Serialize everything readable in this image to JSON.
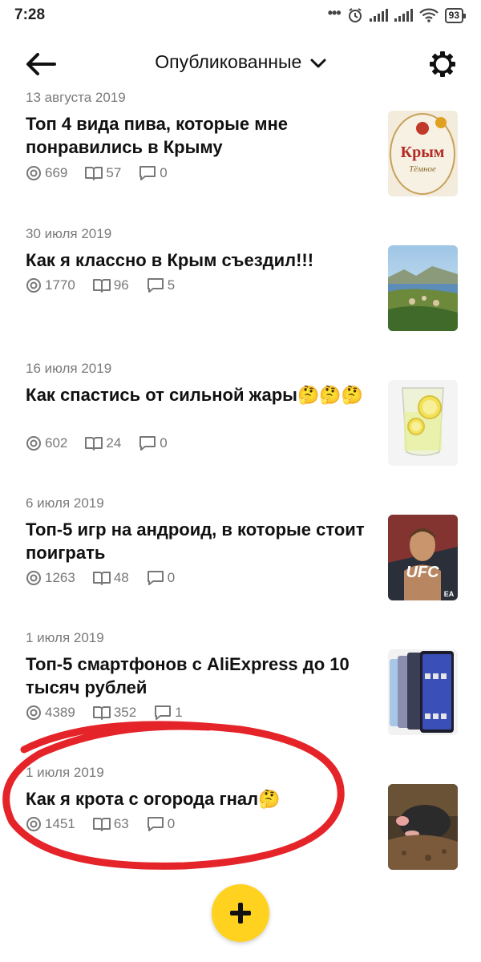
{
  "status": {
    "time": "7:28",
    "dots": "•••",
    "battery": "93"
  },
  "header": {
    "title": "Опубликованные"
  },
  "articles": [
    {
      "date": "13 августа 2019",
      "title": "Топ 4 вида пива, которые мне понравились в Крыму",
      "views": "669",
      "reads": "57",
      "comments": "0",
      "thumb": "beer-label"
    },
    {
      "date": "30 июля 2019",
      "title": "Как я классно в Крым съездил!!!",
      "views": "1770",
      "reads": "96",
      "comments": "5",
      "thumb": "crimea-landscape"
    },
    {
      "date": "16 июля 2019",
      "title": "Как спастись от сильной жары🤔🤔🤔",
      "views": "602",
      "reads": "24",
      "comments": "0",
      "thumb": "lemon-water"
    },
    {
      "date": "6 июля 2019",
      "title": "Топ-5 игр на андроид, в которые стоит поиграть",
      "views": "1263",
      "reads": "48",
      "comments": "0",
      "thumb": "ufc-game"
    },
    {
      "date": "1 июля 2019",
      "title": "Топ-5 смартфонов с AliExpress до 10 тысяч рублей",
      "views": "4389",
      "reads": "352",
      "comments": "1",
      "thumb": "smartphones"
    },
    {
      "date": "1 июля 2019",
      "title": "Как я крота с огорода гнал🤔",
      "views": "1451",
      "reads": "63",
      "comments": "0",
      "thumb": "mole"
    }
  ],
  "colors": {
    "accent": "#ffd21f",
    "annotation": "#e5242a",
    "meta": "#777777"
  }
}
